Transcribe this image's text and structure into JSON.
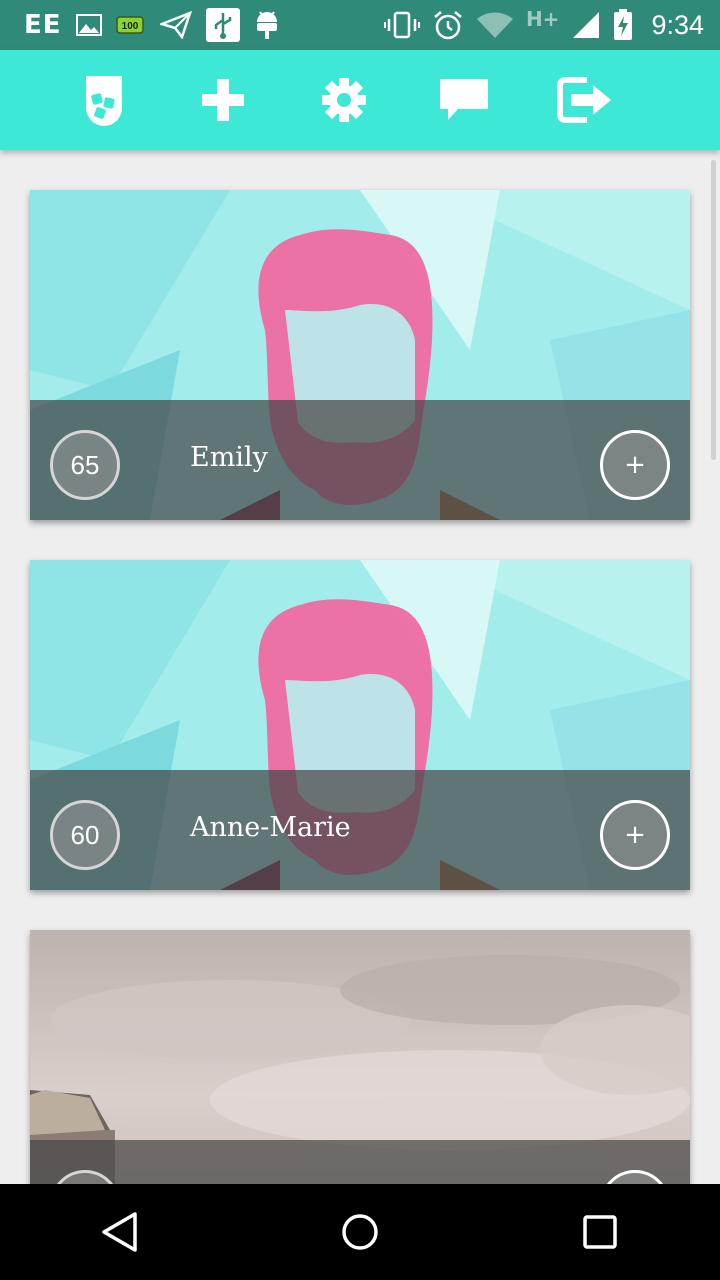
{
  "status_bar": {
    "carrier": "EE",
    "network": "H+",
    "time": "9:34",
    "icons": [
      "image-icon",
      "battery-100-icon",
      "send-icon",
      "usb-icon",
      "android-icon",
      "vibrate-icon",
      "alarm-icon",
      "wifi-icon",
      "signal-icon",
      "battery-charging-icon"
    ]
  },
  "toolbar": {
    "icons": [
      "cup-icon",
      "add-icon",
      "settings-icon",
      "chat-icon",
      "logout-icon"
    ]
  },
  "cards": [
    {
      "score": "65",
      "name": "Emily",
      "action": "+"
    },
    {
      "score": "60",
      "name": "Anne-Marie",
      "action": "+"
    },
    {
      "score": "",
      "name": "",
      "action": ""
    }
  ],
  "navigation": {
    "icons": [
      "back-icon",
      "home-icon",
      "recents-icon"
    ]
  }
}
